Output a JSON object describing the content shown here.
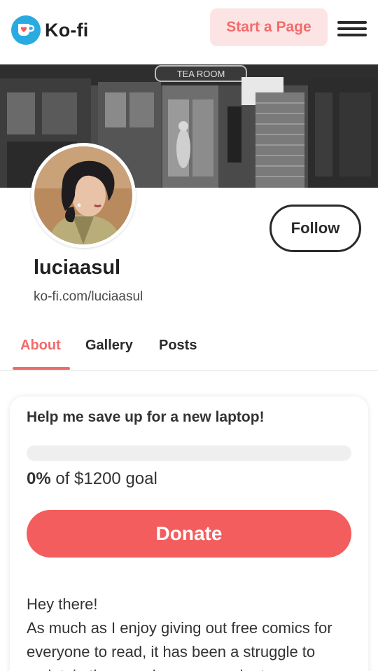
{
  "header": {
    "logo_text": "Ko-fi",
    "start_page_label": "Start a Page",
    "accent_color": "#f45d5d",
    "logo_color": "#29abe0"
  },
  "profile": {
    "username": "luciaasul",
    "url": "ko-fi.com/luciaasul",
    "follow_label": "Follow",
    "banner_sign_text": "TEA ROOM"
  },
  "tabs": [
    {
      "label": "About",
      "active": true
    },
    {
      "label": "Gallery",
      "active": false
    },
    {
      "label": "Posts",
      "active": false
    }
  ],
  "goal": {
    "title": "Help me save up for a new laptop!",
    "percent": "0%",
    "percent_value": 0,
    "goal_text": "of $1200 goal",
    "donate_label": "Donate"
  },
  "about": {
    "line1": "Hey there!",
    "line2": "As much as I enjoy giving out free comics for everyone to read, it has been a struggle to maintain the pace because my laptop"
  }
}
